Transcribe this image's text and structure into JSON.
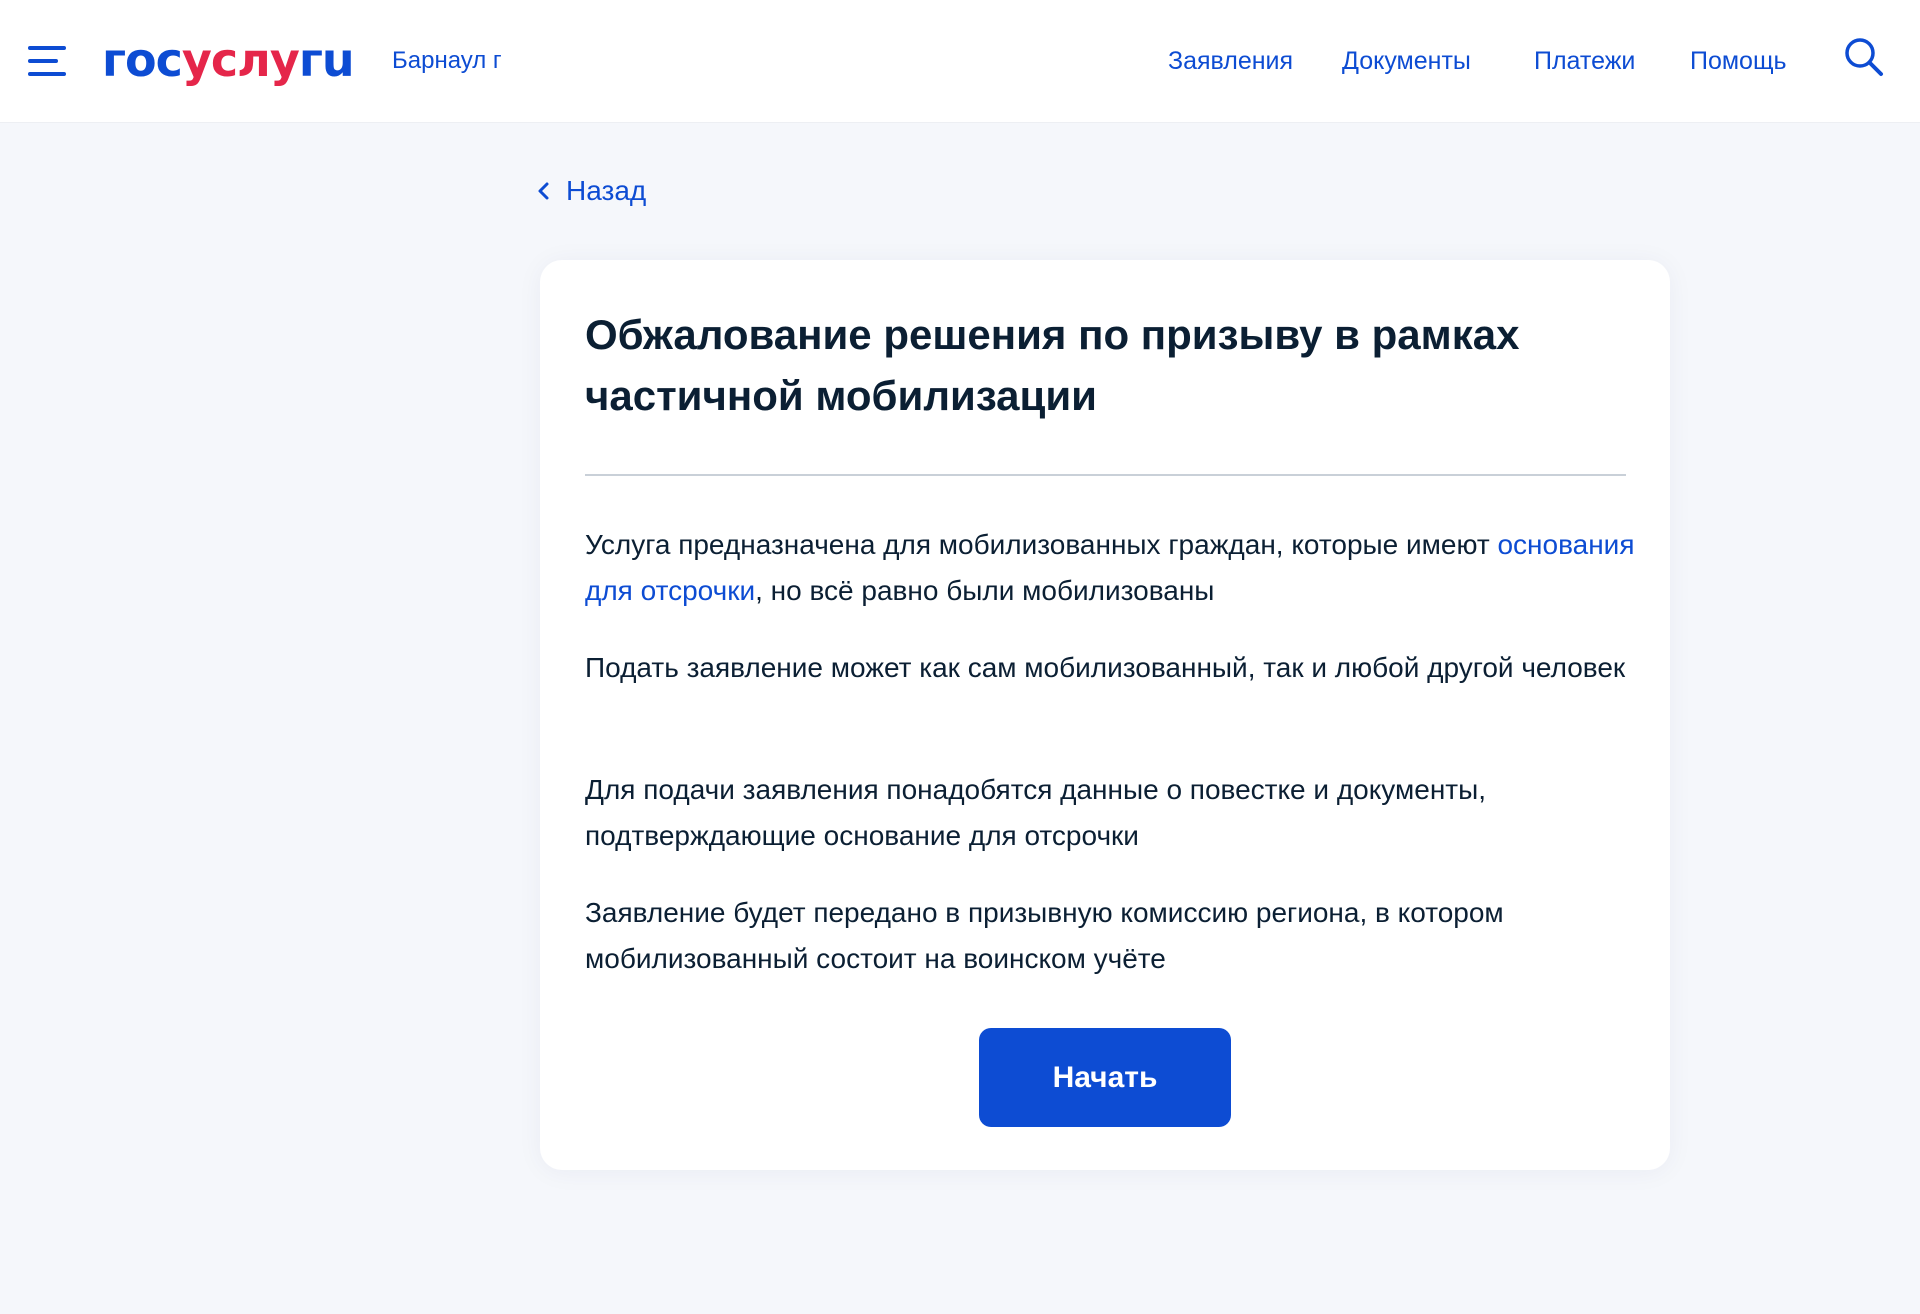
{
  "header": {
    "logo": {
      "part1": "гос",
      "part2": "услу",
      "part3": "гu"
    },
    "city": "Барнаул г",
    "nav": [
      {
        "label": "Заявления"
      },
      {
        "label": "Документы"
      },
      {
        "label": "Платежи"
      },
      {
        "label": "Помощь"
      }
    ],
    "icons": {
      "menu": "hamburger-menu-icon",
      "search": "search-icon"
    }
  },
  "back": {
    "label": "Назад",
    "icon": "chevron-left-icon"
  },
  "card": {
    "title": "Обжалование решения по призыву в рамках частичной мобилизации",
    "paragraphs": {
      "intro_before": "Услуга предназначена для мобилизованных граждан, которые имеют ",
      "intro_link": "основания для отсрочки",
      "intro_after": ", но всё равно были мобилизованы",
      "who": "Подать заявление может как сам мобилизованный, так и любой другой человек",
      "needed": "Для подачи заявления понадобятся данные о повестке и документы, подтверждающие основание для отсрочки",
      "destination": "Заявление будет передано в призывную комиссию региона, в котором мобилизованный состоит на воинском учёте"
    },
    "start_button": "Начать"
  },
  "colors": {
    "brand_blue": "#0d4cd3",
    "brand_red": "#e5264a",
    "text": "#0b1f33",
    "background": "#f5f7fb",
    "card": "#ffffff"
  }
}
